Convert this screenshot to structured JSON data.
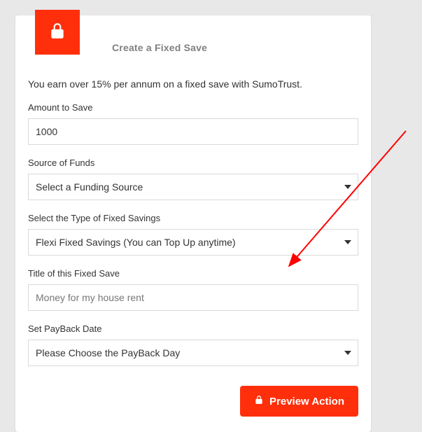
{
  "header": {
    "title": "Create a Fixed Save"
  },
  "subtitle": "You earn over 15% per annum on a fixed save with SumoTrust.",
  "fields": {
    "amount": {
      "label": "Amount to Save",
      "value": "1000"
    },
    "source": {
      "label": "Source of Funds",
      "selected": "Select a Funding Source"
    },
    "type": {
      "label": "Select the Type of Fixed Savings",
      "selected": "Flexi Fixed Savings (You can Top Up anytime)"
    },
    "title_field": {
      "label": "Title of this Fixed Save",
      "placeholder": "Money for my house rent"
    },
    "payback": {
      "label": "Set PayBack Date",
      "selected": "Please Choose the PayBack Day"
    }
  },
  "buttons": {
    "preview": "Preview Action"
  },
  "colors": {
    "accent": "#ff2f0b"
  }
}
